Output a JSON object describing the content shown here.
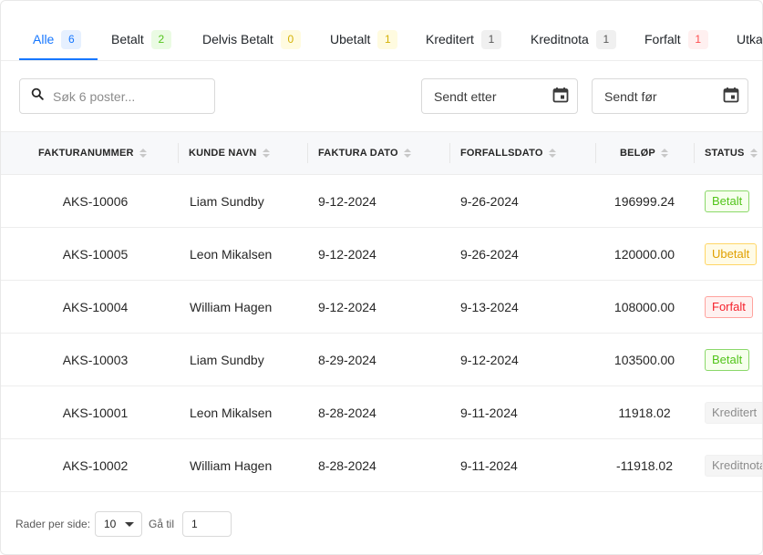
{
  "tabs": [
    {
      "label": "Alle",
      "count": "6",
      "badge": "blue",
      "active": true
    },
    {
      "label": "Betalt",
      "count": "2",
      "badge": "green"
    },
    {
      "label": "Delvis Betalt",
      "count": "0",
      "badge": "yellow"
    },
    {
      "label": "Ubetalt",
      "count": "1",
      "badge": "yellow"
    },
    {
      "label": "Kreditert",
      "count": "1",
      "badge": "gray"
    },
    {
      "label": "Kreditnota",
      "count": "1",
      "badge": "gray"
    },
    {
      "label": "Forfalt",
      "count": "1",
      "badge": "red"
    },
    {
      "label": "Utkast",
      "count": "",
      "badge": "gray"
    }
  ],
  "search": {
    "placeholder": "Søk 6 poster...",
    "icon": "search-icon"
  },
  "filters": {
    "sent_after": {
      "label": "Sendt etter",
      "icon": "calendar-icon"
    },
    "sent_before": {
      "label": "Sendt før",
      "icon": "calendar-icon"
    }
  },
  "table": {
    "columns": [
      "FAKTURANUMMER",
      "KUNDE NAVN",
      "FAKTURA DATO",
      "FORFALLSDATO",
      "BELØP",
      "STATUS"
    ],
    "rows": [
      {
        "invoice": "AKS-10006",
        "customer": "Liam Sundby",
        "invoice_date": "9-12-2024",
        "due_date": "9-26-2024",
        "amount": "196999.24",
        "status": "Betalt"
      },
      {
        "invoice": "AKS-10005",
        "customer": "Leon Mikalsen",
        "invoice_date": "9-12-2024",
        "due_date": "9-26-2024",
        "amount": "120000.00",
        "status": "Ubetalt"
      },
      {
        "invoice": "AKS-10004",
        "customer": "William Hagen",
        "invoice_date": "9-12-2024",
        "due_date": "9-13-2024",
        "amount": "108000.00",
        "status": "Forfalt"
      },
      {
        "invoice": "AKS-10003",
        "customer": "Liam Sundby",
        "invoice_date": "8-29-2024",
        "due_date": "9-12-2024",
        "amount": "103500.00",
        "status": "Betalt"
      },
      {
        "invoice": "AKS-10001",
        "customer": "Leon Mikalsen",
        "invoice_date": "8-28-2024",
        "due_date": "9-11-2024",
        "amount": "11918.02",
        "status": "Kreditert"
      },
      {
        "invoice": "AKS-10002",
        "customer": "William Hagen",
        "invoice_date": "8-28-2024",
        "due_date": "9-11-2024",
        "amount": "-11918.02",
        "status": "Kreditnota"
      }
    ]
  },
  "pagination": {
    "rows_per_page_label": "Rader per side:",
    "rows_per_page": "10",
    "goto_label": "Gå til",
    "goto_value": "1"
  },
  "colors": {
    "accent": "#1677ff",
    "paid": "#52c41a",
    "unpaid": "#e0a000",
    "overdue": "#f5222d",
    "muted": "#8c8c8c"
  }
}
